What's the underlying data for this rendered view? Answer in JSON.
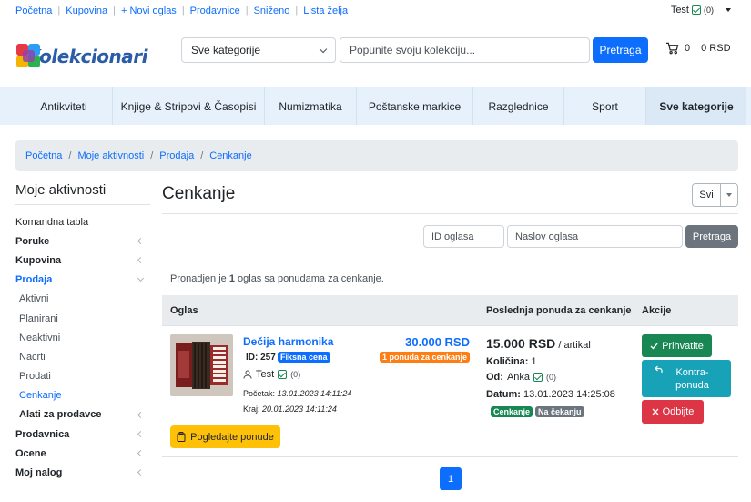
{
  "topbar": {
    "links": [
      "Početna",
      "Kupovina",
      "+ Novi oglas",
      "Prodavnice",
      "Sniženo",
      "Lista želja"
    ],
    "user_name": "Test",
    "user_rating": "(0)"
  },
  "header": {
    "logo_text": "Kolekcionari",
    "category_select_value": "Sve kategorije",
    "search_placeholder": "Popunite svoju kolekciju...",
    "search_button": "Pretraga",
    "cart_count": "0",
    "cart_total": "0 RSD"
  },
  "catnav": {
    "items": [
      "Antikviteti",
      "Knjige & Stripovi & Časopisi",
      "Numizmatika",
      "Poštanske markice",
      "Razglednice",
      "Sport",
      "Sve kategorije"
    ]
  },
  "breadcrumb": {
    "items": [
      "Početna",
      "Moje aktivnosti",
      "Prodaja",
      "Cenkanje"
    ]
  },
  "sidebar": {
    "title": "Moje aktivnosti",
    "items": [
      "Komandna tabla",
      "Poruke",
      "Kupovina",
      "Prodaja",
      "Aktivni",
      "Planirani",
      "Neaktivni",
      "Nacrti",
      "Prodati",
      "Cenkanje",
      "Alati za prodavce",
      "Prodavnica",
      "Ocene",
      "Moj nalog"
    ]
  },
  "main": {
    "title": "Cenkanje",
    "filter_value": "Svi",
    "id_placeholder": "ID oglasa",
    "title_placeholder": "Naslov oglasa",
    "search_button": "Pretraga",
    "found_pre": "Pronadjen je ",
    "found_count": "1",
    "found_post": " oglas sa ponudama za cenkanje.",
    "columns": [
      "Oglas",
      "Poslednja ponuda za cenkanje",
      "Akcije"
    ],
    "pager_page": "1"
  },
  "listing": {
    "title": "Dečija harmonika",
    "id_label": "ID: 257",
    "fixed_badge": "Fiksna cena",
    "price": "30.000 RSD",
    "offers_badge": "1 ponuda za cenkanje",
    "seller": "Test",
    "seller_rating": "(0)",
    "start_label": "Početak: ",
    "start_value": "13.01.2023 14:11:24",
    "end_label": "Kraj: ",
    "end_value": "20.01.2023 14:11:24",
    "view_offers_button": "Pogledajte ponude"
  },
  "offer": {
    "price": "15.000 RSD",
    "unit": " / artikal",
    "qty_label": "Količina:",
    "qty_value": "1",
    "from_label": "Od:",
    "from_value": "Anka",
    "from_rating": "(0)",
    "date_label": "Datum:",
    "date_value": "13.01.2023 14:25:08",
    "type_badge": "Cenkanje",
    "status_badge": "Na čekanju"
  },
  "actions": {
    "accept": "Prihvatite",
    "counter": "Kontra-ponuda",
    "reject": "Odbijte"
  }
}
